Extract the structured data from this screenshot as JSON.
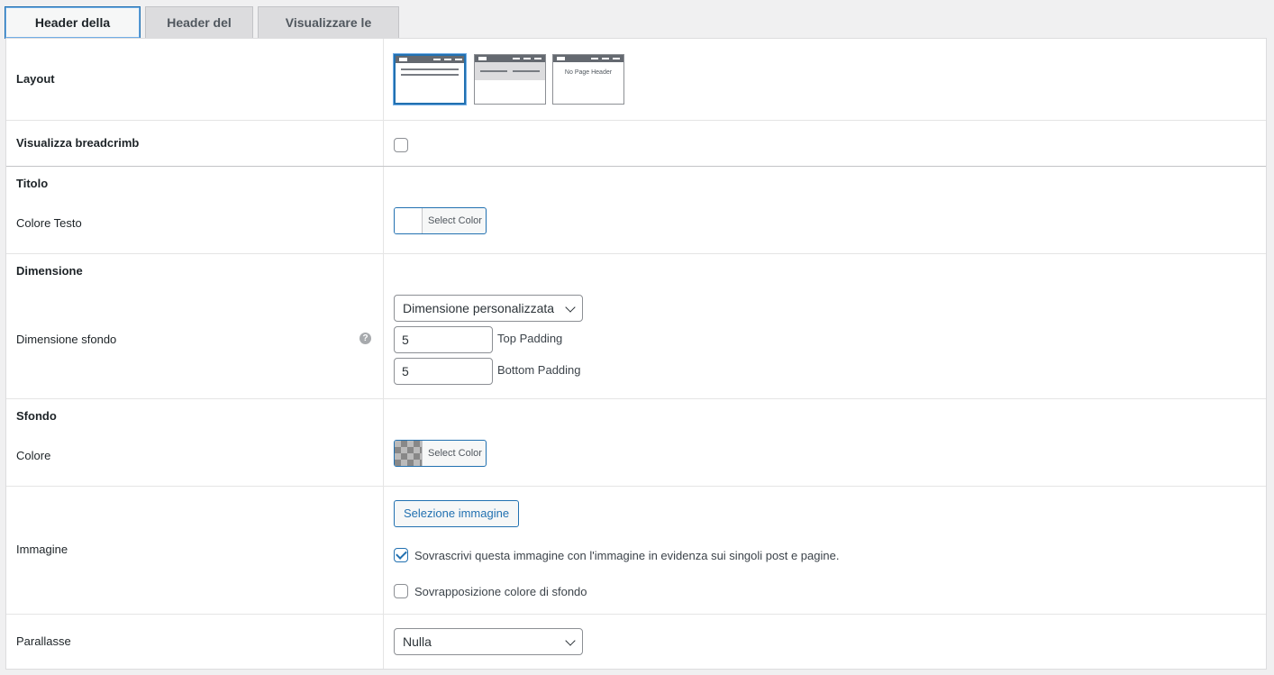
{
  "tabs": [
    {
      "label": "Header della pagina",
      "active": true
    },
    {
      "label": "Header del sito",
      "active": false
    },
    {
      "label": "Visualizzare le regole",
      "active": false
    }
  ],
  "layout": {
    "label": "Layout",
    "options": [
      "standard",
      "full-width-band",
      "no-page-header"
    ],
    "selected": "standard",
    "no_header_text": "No Page Header"
  },
  "breadcrumb": {
    "label": "Visualizza breadcrimb",
    "checked": false
  },
  "title_section": {
    "heading": "Titolo",
    "text_color_label": "Colore Testo",
    "color_button": "Select Color"
  },
  "dimension_section": {
    "heading": "Dimensione",
    "size_label": "Dimensione sfondo",
    "help_icon": "?",
    "size_select": "Dimensione personalizzata",
    "top_padding_value": "5",
    "top_padding_label": "Top Padding",
    "bottom_padding_value": "5",
    "bottom_padding_label": "Bottom Padding"
  },
  "background_section": {
    "heading": "Sfondo",
    "color_label": "Colore",
    "color_button": "Select Color"
  },
  "image_section": {
    "label": "Immagine",
    "select_button": "Selezione immagine",
    "override_label": "Sovrascrivi questa immagine con l'immagine in evidenza sui singoli post e pagine.",
    "override_checked": true,
    "overlay_label": "Sovrapposizione colore di sfondo",
    "overlay_checked": false
  },
  "parallax": {
    "label": "Parallasse",
    "value": "Nulla"
  },
  "colors": {
    "accent": "#2271b1",
    "border": "#c3c4c7",
    "bg": "#f0f0f1"
  }
}
